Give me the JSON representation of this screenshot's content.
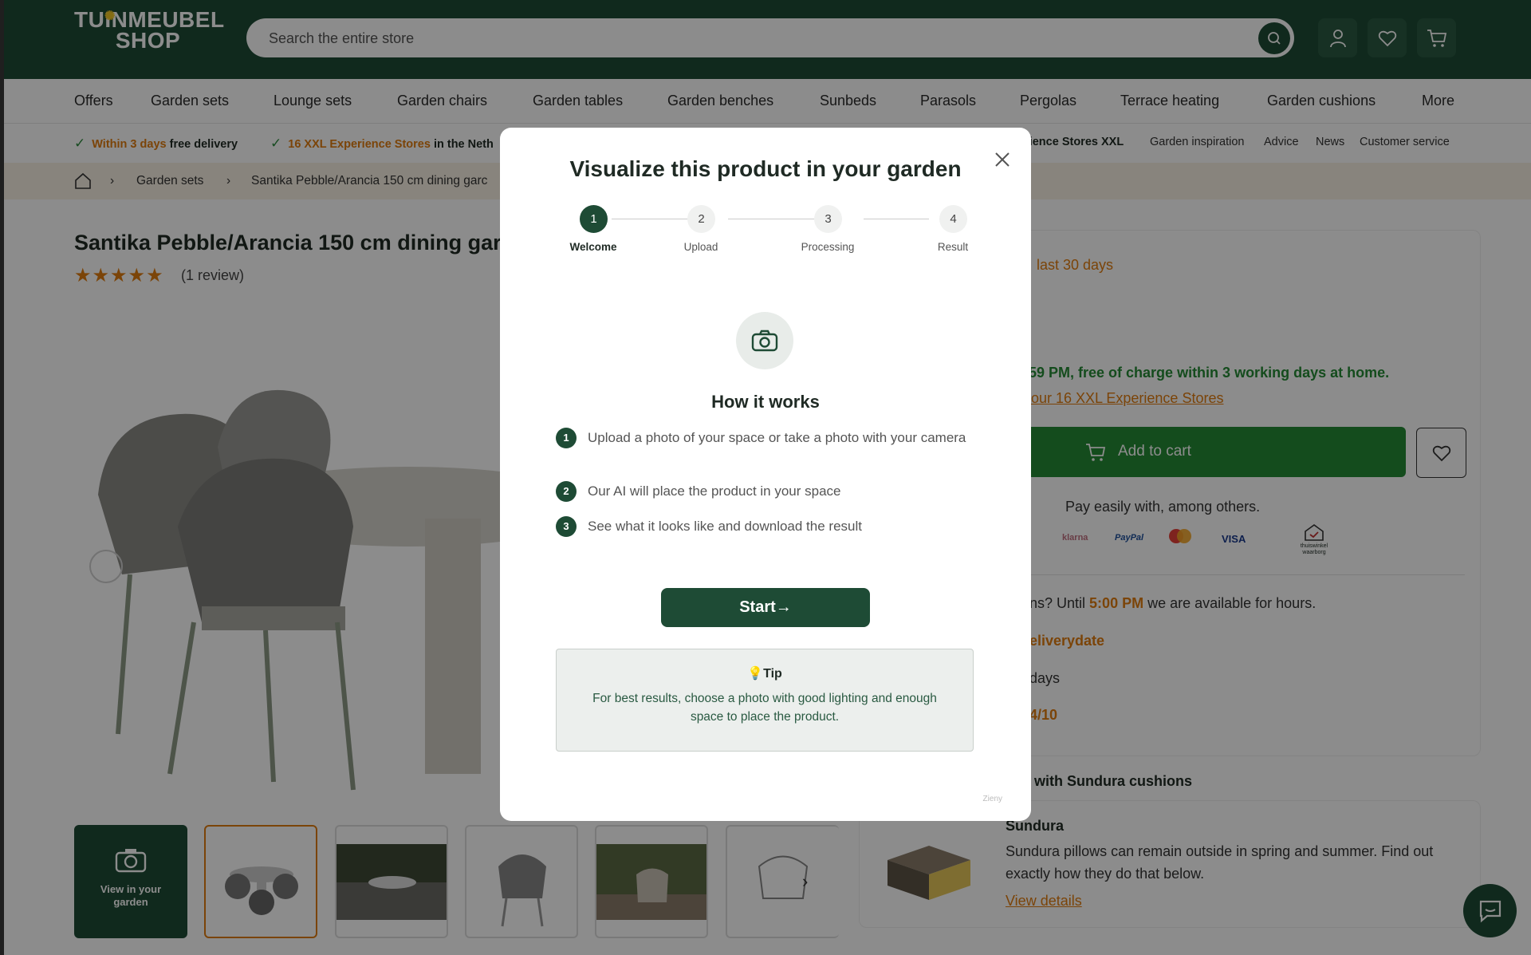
{
  "header": {
    "logo_line1": "TUINMEUBEL",
    "logo_line2": "SHOP",
    "search_placeholder": "Search the entire store"
  },
  "nav": [
    "Offers",
    "Garden sets",
    "Lounge sets",
    "Garden chairs",
    "Garden tables",
    "Garden benches",
    "Sunbeds",
    "Parasols",
    "Pergolas",
    "Terrace heating",
    "Garden cushions",
    "More"
  ],
  "usp": {
    "u1_bold": "Within 3 days",
    "u1_rest": " free delivery",
    "u2_bold": "16 XXL Experience Stores",
    "u2_rest": " in the Neth",
    "u3": "erience Stores XXL",
    "links": [
      "Garden inspiration",
      "Advice",
      "News",
      "Customer service"
    ]
  },
  "breadcrumb": [
    "Garden sets",
    "Santika Pebble/Arancia 150 cm dining garc"
  ],
  "product": {
    "title": "Santika Pebble/Arancia 150 cm dining garc",
    "stars": "★★★★★",
    "reviews": "(1 review)"
  },
  "right": {
    "badge": "last 30 days",
    "delivery": "59 PM, free of charge within 3 working days at home.",
    "stores_link": "our 16 XXL Experience Stores",
    "add_to_cart": "Add to cart",
    "pay_text": "Pay easily with, among others.",
    "pay_logos": [
      "klarna",
      "PayPal",
      "mastercard",
      "VISA",
      "thuiswinkel waarborg"
    ],
    "q_prefix": "ons? Until ",
    "q_time": "5:00 PM",
    "q_suffix": " we are available for hours.",
    "deliverydate": "eliverydate",
    "days": "days",
    "score": "4/10",
    "sundura_heading": "with Sundura cushions",
    "sundura_title": "Sundura",
    "sundura_desc": "Sundura pillows can remain outside in spring and summer. Find out exactly how they do that below.",
    "sundura_link": "View details"
  },
  "thumbs": {
    "view_in_garden": "View in your garden"
  },
  "modal": {
    "title": "Visualize this product in your garden",
    "steps": [
      {
        "num": "1",
        "label": "Welcome"
      },
      {
        "num": "2",
        "label": "Upload"
      },
      {
        "num": "3",
        "label": "Processing"
      },
      {
        "num": "4",
        "label": "Result"
      }
    ],
    "how_title": "How it works",
    "how_items": [
      {
        "num": "1",
        "text": "Upload a photo of your space or take a photo with your camera"
      },
      {
        "num": "2",
        "text": "Our AI will place the product in your space"
      },
      {
        "num": "3",
        "text": "See what it looks like and download the result"
      }
    ],
    "start_label": "Start→",
    "tip_title": "💡Tip",
    "tip_body": "For best results, choose a photo with good lighting and enough space to place the product.",
    "brand": "Zieny"
  },
  "colors": {
    "brand_green": "#1e4b35",
    "cta_green": "#268a35",
    "accent_orange": "#e07c10"
  }
}
